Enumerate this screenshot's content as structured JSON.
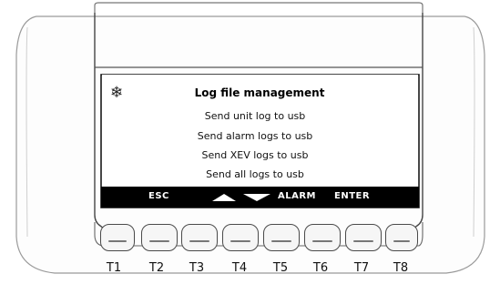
{
  "screen": {
    "icon": "snowflake-icon",
    "title": "Log file management",
    "menu_items": [
      "Send unit log to usb",
      "Send alarm logs to usb",
      "Send XEV logs to usb",
      "Send all logs to usb"
    ]
  },
  "softkeys": {
    "esc": "ESC",
    "up": "up-arrow-icon",
    "down": "down-arrow-icon",
    "alarm": "ALARM",
    "enter": "ENTER"
  },
  "keys": [
    "T1",
    "T2",
    "T3",
    "T4",
    "T5",
    "T6",
    "T7",
    "T8"
  ]
}
